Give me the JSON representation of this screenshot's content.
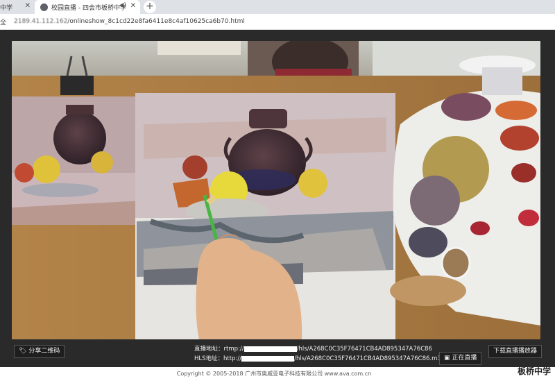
{
  "browser": {
    "tabs": [
      {
        "label": "中学",
        "active": false
      },
      {
        "label": "校园直播 - 四会市板桥中学",
        "active": true
      }
    ],
    "new_tab_symbol": "+",
    "address": {
      "security_text": "全",
      "url_host": "2189.41.112.162",
      "url_path": "/onlineshow_8c1cd22e8fa6411e8c4af10625ca6b70.html"
    }
  },
  "player": {
    "share_button": "分享二维码",
    "rtmp_label": "直播地址：rtmp://",
    "rtmp_suffix": "/hls/A268C0C35F76471CB4AD895347A76C86",
    "hls_label": "HLS地址：http://",
    "hls_suffix": "/hls/A268C0C35F76471CB4AD895347A76C86.m3u8",
    "live_button": "正在直播",
    "download_button": "下载直播播放器"
  },
  "footer": {
    "copyright": "Copyright © 2005-2018 广州市奥威亚电子科技有限公司 www.ava.com.cn",
    "watermark": "板桥中学"
  },
  "colors": {
    "tabbar": "#dee1e6",
    "player_bg": "#2a2a2a",
    "video_bg": "#7a6e60"
  }
}
